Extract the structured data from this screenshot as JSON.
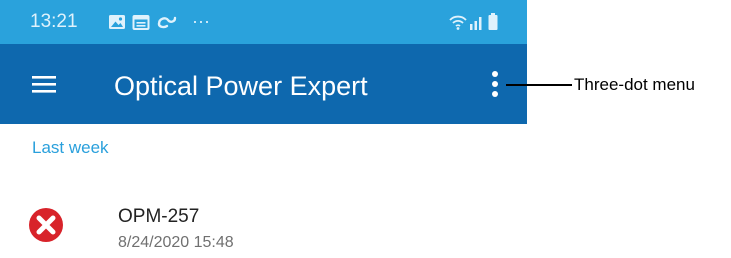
{
  "status_bar": {
    "time": "13:21",
    "overflow_indicator": "···",
    "icons_left": [
      "image-notification-icon",
      "calendar-notification-icon",
      "sync-notification-icon"
    ],
    "icons_right": [
      "wifi-icon",
      "signal-icon",
      "battery-icon"
    ]
  },
  "app_bar": {
    "title": "Optical Power Expert",
    "menu_icon": "hamburger-menu-icon",
    "overflow_icon": "three-dot-menu-icon"
  },
  "content": {
    "section_header": "Last week",
    "items": [
      {
        "title": "OPM-257",
        "subtitle": "8/24/2020 15:48",
        "status_icon": "error-icon"
      }
    ]
  },
  "annotation": {
    "label": "Three-dot menu"
  },
  "colors": {
    "status_bar": "#2aa2dc",
    "app_bar": "#0e68ae",
    "accent": "#2aa0dc",
    "error": "#d8232a"
  }
}
